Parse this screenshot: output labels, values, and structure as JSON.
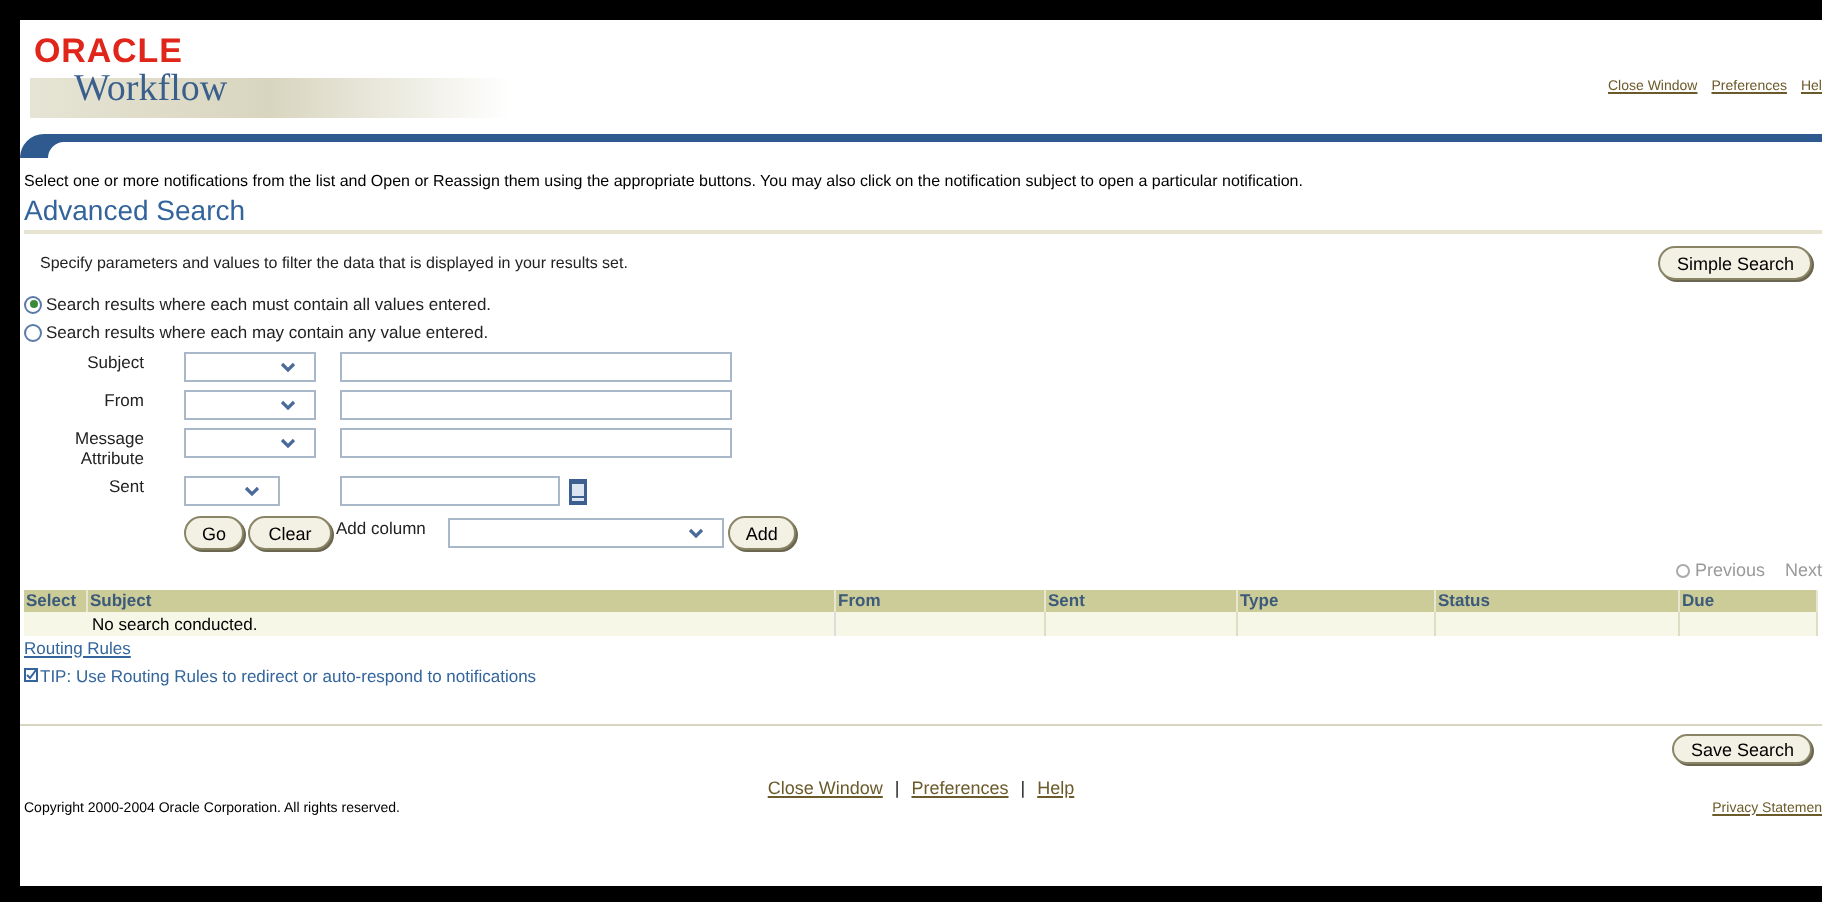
{
  "logo": {
    "brand": "ORACLE",
    "product": "Workflow"
  },
  "global_links": [
    "Close Window",
    "Preferences",
    "Hel"
  ],
  "instruction": "Select one or more notifications from the list and Open or Reassign them using the appropriate buttons.  You may also click on the notification subject to open a particular notification.",
  "heading": "Advanced Search",
  "description": "Specify parameters and values to filter the data that is displayed in your results set.",
  "simple_search_button": "Simple Search",
  "match_options": [
    {
      "label": "Search results where each must contain all values entered.",
      "selected": true
    },
    {
      "label": "Search results where each may contain any value entered.",
      "selected": false
    }
  ],
  "criteria": [
    {
      "label": "Subject",
      "kind": "text"
    },
    {
      "label": "From",
      "kind": "text"
    },
    {
      "label": "Message Attribute",
      "kind": "text"
    },
    {
      "label": "Sent",
      "kind": "date"
    }
  ],
  "go_button": "Go",
  "clear_button": "Clear",
  "add_column_label": "Add column",
  "add_button": "Add",
  "pager": {
    "previous": "Previous",
    "next": "Next"
  },
  "table": {
    "columns": [
      "Select",
      "Subject",
      "From",
      "Sent",
      "Type",
      "Status",
      "Due"
    ],
    "empty_message": "No search conducted."
  },
  "routing_rules_link": "Routing Rules",
  "tip": "TIP: Use Routing Rules to redirect or auto-respond to notifications",
  "save_search_button": "Save Search",
  "footer_links": [
    "Close Window",
    "Preferences",
    "Help"
  ],
  "footer_separator": "|",
  "copyright": "Copyright 2000-2004 Oracle Corporation. All rights reserved.",
  "privacy_link": "Privacy Statemen"
}
